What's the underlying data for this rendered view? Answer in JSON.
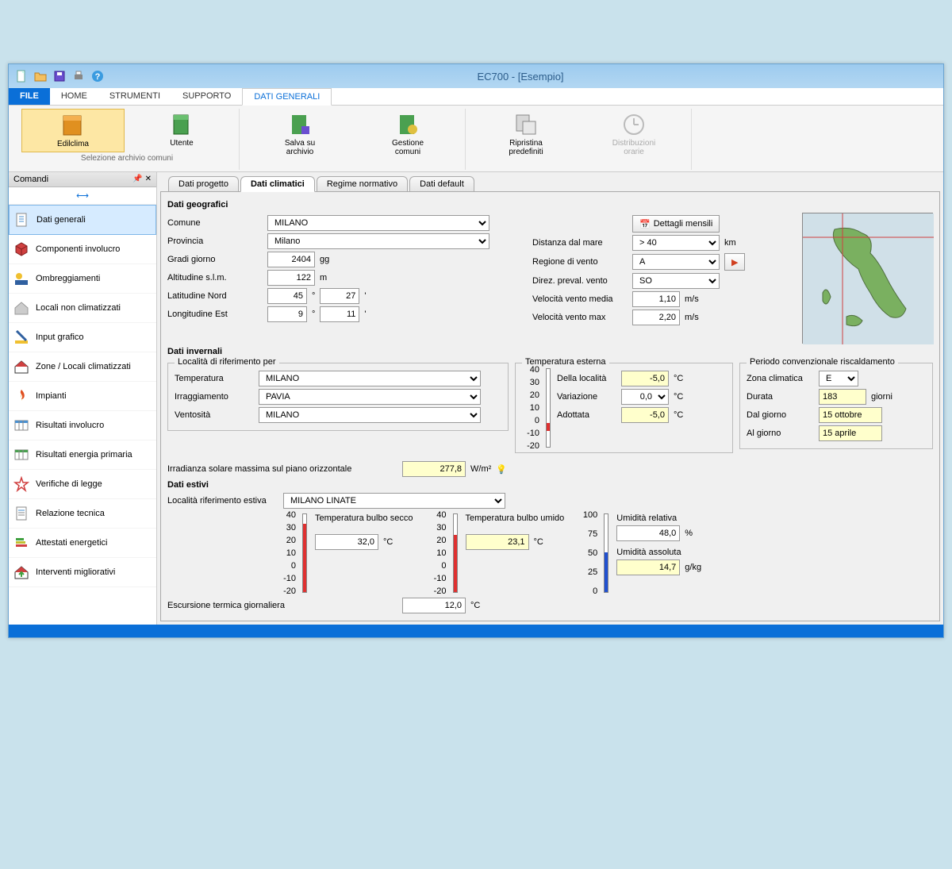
{
  "titlebar": {
    "title": "EC700 - [Esempio]"
  },
  "menubar": {
    "file": "FILE",
    "tabs": [
      "HOME",
      "STRUMENTI",
      "SUPPORTO",
      "DATI GENERALI"
    ],
    "active": "DATI GENERALI"
  },
  "ribbon": {
    "group1_title": "Selezione archivio comuni",
    "edilclima": "Edilclima",
    "utente": "Utente",
    "salva": "Salva su\narchivio",
    "gestione": "Gestione\ncomuni",
    "ripristina": "Ripristina\npredefiniti",
    "distribuzioni": "Distribuzioni\norarie"
  },
  "sidebar": {
    "header": "Comandi",
    "items": [
      "Dati generali",
      "Componenti involucro",
      "Ombreggiamenti",
      "Locali non climatizzati",
      "Input grafico",
      "Zone / Locali climatizzati",
      "Impianti",
      "Risultati involucro",
      "Risultati energia primaria",
      "Verifiche di legge",
      "Relazione tecnica",
      "Attestati energetici",
      "Interventi migliorativi"
    ]
  },
  "content_tabs": [
    "Dati progetto",
    "Dati climatici",
    "Regime normativo",
    "Dati default"
  ],
  "geo": {
    "section": "Dati geografici",
    "comune_lbl": "Comune",
    "comune": "MILANO",
    "provincia_lbl": "Provincia",
    "provincia": "Milano",
    "gradi_lbl": "Gradi giorno",
    "gradi": "2404",
    "gradi_unit": "gg",
    "alt_lbl": "Altitudine s.l.m.",
    "alt": "122",
    "alt_unit": "m",
    "lat_lbl": "Latitudine Nord",
    "lat_d": "45",
    "lat_m": "27",
    "lon_lbl": "Longitudine Est",
    "lon_d": "9",
    "lon_m": "11",
    "dettagli": "Dettagli mensili",
    "dist_lbl": "Distanza dal mare",
    "dist": "> 40",
    "dist_unit": "km",
    "regv_lbl": "Regione di vento",
    "regv": "A",
    "dirv_lbl": "Direz. preval. vento",
    "dirv": "SO",
    "vmed_lbl": "Velocità vento media",
    "vmed": "1,10",
    "vmed_unit": "m/s",
    "vmax_lbl": "Velocità vento max",
    "vmax": "2,20",
    "vmax_unit": "m/s"
  },
  "inv": {
    "section": "Dati invernali",
    "loc_legend": "Località di riferimento per",
    "temp_lbl": "Temperatura",
    "temp": "MILANO",
    "irr_lbl": "Irraggiamento",
    "irr": "PAVIA",
    "vent_lbl": "Ventosità",
    "vent": "MILANO",
    "text_legend": "Temperatura esterna",
    "tloc_lbl": "Della località",
    "tloc": "-5,0",
    "tloc_unit": "°C",
    "tvar_lbl": "Variazione",
    "tvar": "0,0",
    "tvar_unit": "°C",
    "tad_lbl": "Adottata",
    "tad": "-5,0",
    "tad_unit": "°C",
    "per_legend": "Periodo convenzionale riscaldamento",
    "zona_lbl": "Zona climatica",
    "zona": "E",
    "dur_lbl": "Durata",
    "dur": "183",
    "dur_unit": "giorni",
    "dal_lbl": "Dal giorno",
    "dal": "15 ottobre",
    "al_lbl": "Al giorno",
    "al": "15 aprile",
    "irrad_lbl": "Irradianza solare massima sul piano orizzontale",
    "irrad": "277,8",
    "irrad_unit": "W/m²"
  },
  "est": {
    "section": "Dati estivi",
    "loc_lbl": "Località riferimento estiva",
    "loc": "MILANO LINATE",
    "tbs_lbl": "Temperatura bulbo secco",
    "tbs": "32,0",
    "tbs_unit": "°C",
    "tbu_lbl": "Temperatura bulbo umido",
    "tbu": "23,1",
    "tbu_unit": "°C",
    "ur_lbl": "Umidità relativa",
    "ur": "48,0",
    "ur_unit": "%",
    "ua_lbl": "Umidità assoluta",
    "ua": "14,7",
    "ua_unit": "g/kg",
    "esc_lbl": "Escursione termica giornaliera",
    "esc": "12,0",
    "esc_unit": "°C"
  },
  "thermo_ticks_temp": [
    "40",
    "30",
    "20",
    "10",
    "0",
    "-10",
    "-20"
  ],
  "thermo_ticks_hum": [
    "100",
    "75",
    "50",
    "25",
    "0"
  ]
}
